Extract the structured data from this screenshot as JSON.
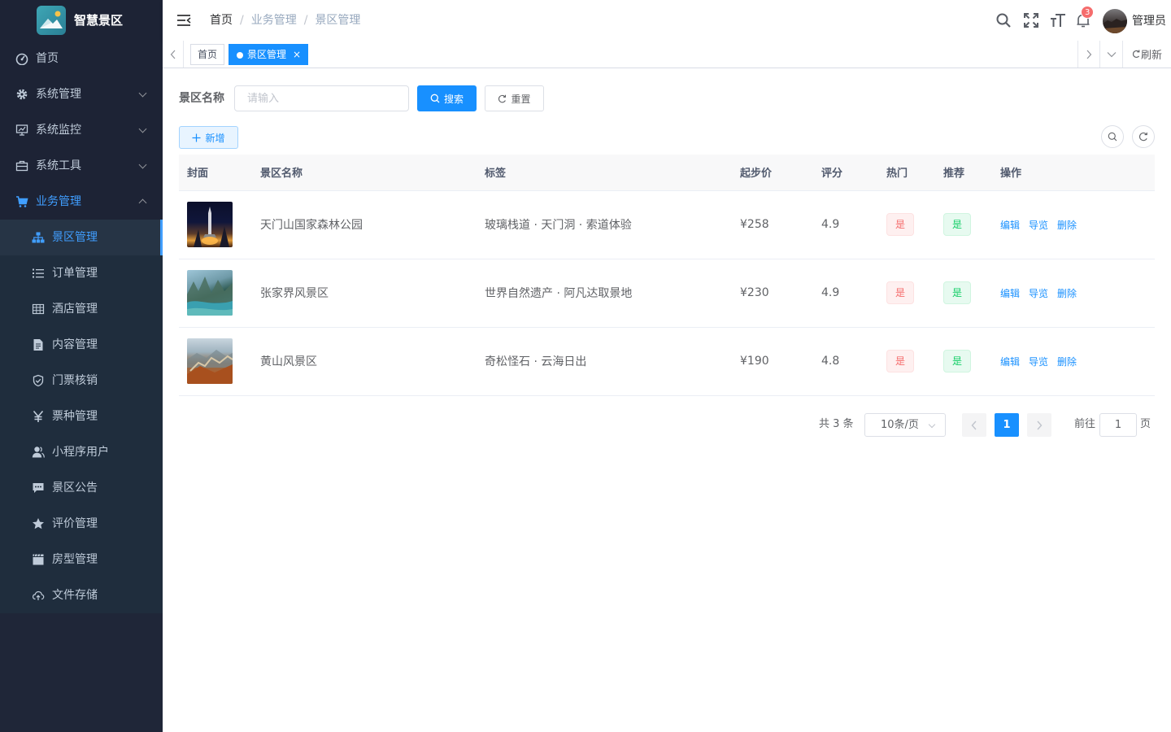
{
  "app": {
    "title": "智慧景区"
  },
  "sidebar": {
    "items": [
      {
        "label": "首页",
        "icon": "dashboard-icon"
      },
      {
        "label": "系统管理",
        "icon": "gear-icon"
      },
      {
        "label": "系统监控",
        "icon": "monitor-icon"
      },
      {
        "label": "系统工具",
        "icon": "toolbox-icon"
      },
      {
        "label": "业务管理",
        "icon": "cart-icon"
      }
    ],
    "subitems": [
      {
        "label": "景区管理",
        "icon": "tree-icon"
      },
      {
        "label": "订单管理",
        "icon": "list-icon"
      },
      {
        "label": "酒店管理",
        "icon": "table-icon"
      },
      {
        "label": "内容管理",
        "icon": "document-icon"
      },
      {
        "label": "门票核销",
        "icon": "shield-check-icon"
      },
      {
        "label": "票种管理",
        "icon": "yen-icon"
      },
      {
        "label": "小程序用户",
        "icon": "user-icon"
      },
      {
        "label": "景区公告",
        "icon": "message-icon"
      },
      {
        "label": "评价管理",
        "icon": "star-icon"
      },
      {
        "label": "房型管理",
        "icon": "clapperboard-icon"
      },
      {
        "label": "文件存储",
        "icon": "cloud-upload-icon"
      }
    ]
  },
  "header": {
    "breadcrumb": [
      "首页",
      "业务管理",
      "景区管理"
    ],
    "notification_count": "3",
    "username": "管理员"
  },
  "tags_view": {
    "tags": [
      "首页",
      "景区管理"
    ],
    "close": "×",
    "refresh_label": "刷新"
  },
  "search": {
    "label": "景区名称",
    "placeholder": "请输入",
    "search_label": "搜索",
    "reset_label": "重置"
  },
  "toolbar": {
    "add_label": "新增"
  },
  "table": {
    "columns": [
      "封面",
      "景区名称",
      "标签",
      "起步价",
      "评分",
      "热门",
      "推荐",
      "操作"
    ],
    "rows": [
      {
        "name": "天门山国家森林公园",
        "tags": "玻璃栈道 · 天门洞 · 索道体验",
        "price": "¥258",
        "rating": "4.9",
        "hot": "是",
        "recommend": "是"
      },
      {
        "name": "张家界风景区",
        "tags": "世界自然遗产 · 阿凡达取景地",
        "price": "¥230",
        "rating": "4.9",
        "hot": "是",
        "recommend": "是"
      },
      {
        "name": "黄山风景区",
        "tags": "奇松怪石 · 云海日出",
        "price": "¥190",
        "rating": "4.8",
        "hot": "是",
        "recommend": "是"
      }
    ],
    "actions": [
      "编辑",
      "导览",
      "删除"
    ]
  },
  "pagination": {
    "total": "共 3 条",
    "page_size": "10条/页",
    "current_page": "1",
    "goto_label": "前往",
    "goto_value": "1",
    "page_suffix": "页"
  },
  "colors": {
    "sidebar_bg": "#1d2335",
    "accent": "#1890ff",
    "danger": "#f56c6c",
    "success": "#13ce66"
  }
}
